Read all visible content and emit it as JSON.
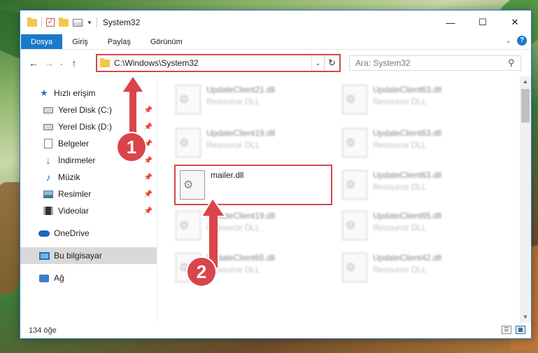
{
  "window": {
    "title": "System32",
    "controls": {
      "minimize": "—",
      "maximize": "☐",
      "close": "✕"
    }
  },
  "ribbon": {
    "tabs": [
      "Dosya",
      "Giriş",
      "Paylaş",
      "Görünüm"
    ],
    "help": "?"
  },
  "navigation": {
    "back": "←",
    "forward": "→",
    "recent": "⌄",
    "up": "↑",
    "address": "C:\\Windows\\System32",
    "refresh": "↻",
    "search_placeholder": "Ara: System32"
  },
  "sidebar": {
    "quick_access": "Hızlı erişim",
    "items": [
      "Yerel Disk (C:)",
      "Yerel Disk (D:)",
      "Belgeler",
      "İndirmeler",
      "Müzik",
      "Resimler",
      "Videolar"
    ],
    "onedrive": "OneDrive",
    "this_pc": "Bu bilgisayar",
    "network": "Ağ"
  },
  "files": [
    {
      "name": "UpdateClient21.dll",
      "type": "Resource DLL"
    },
    {
      "name": "UpdateClient63.dll",
      "type": "Resource DLL"
    },
    {
      "name": "UpdateClient19.dll",
      "type": "Resource DLL"
    },
    {
      "name": "UpdateClient63.dll",
      "type": "Resource DLL"
    },
    {
      "name": "mailer.dll",
      "type": ""
    },
    {
      "name": "UpdateClient63.dll",
      "type": "Resource DLL"
    },
    {
      "name": "UpdateClient19.dll",
      "type": "Resource DLL"
    },
    {
      "name": "UpdateClient65.dll",
      "type": "Resource DLL"
    },
    {
      "name": "UpdateClient65.dll",
      "type": "Resource DLL"
    },
    {
      "name": "UpdateClient42.dll",
      "type": "Resource DLL"
    }
  ],
  "status": {
    "item_count": "134 öğe"
  },
  "callouts": [
    "1",
    "2"
  ],
  "colors": {
    "accent": "#1979ca",
    "highlight": "#d9454b"
  }
}
